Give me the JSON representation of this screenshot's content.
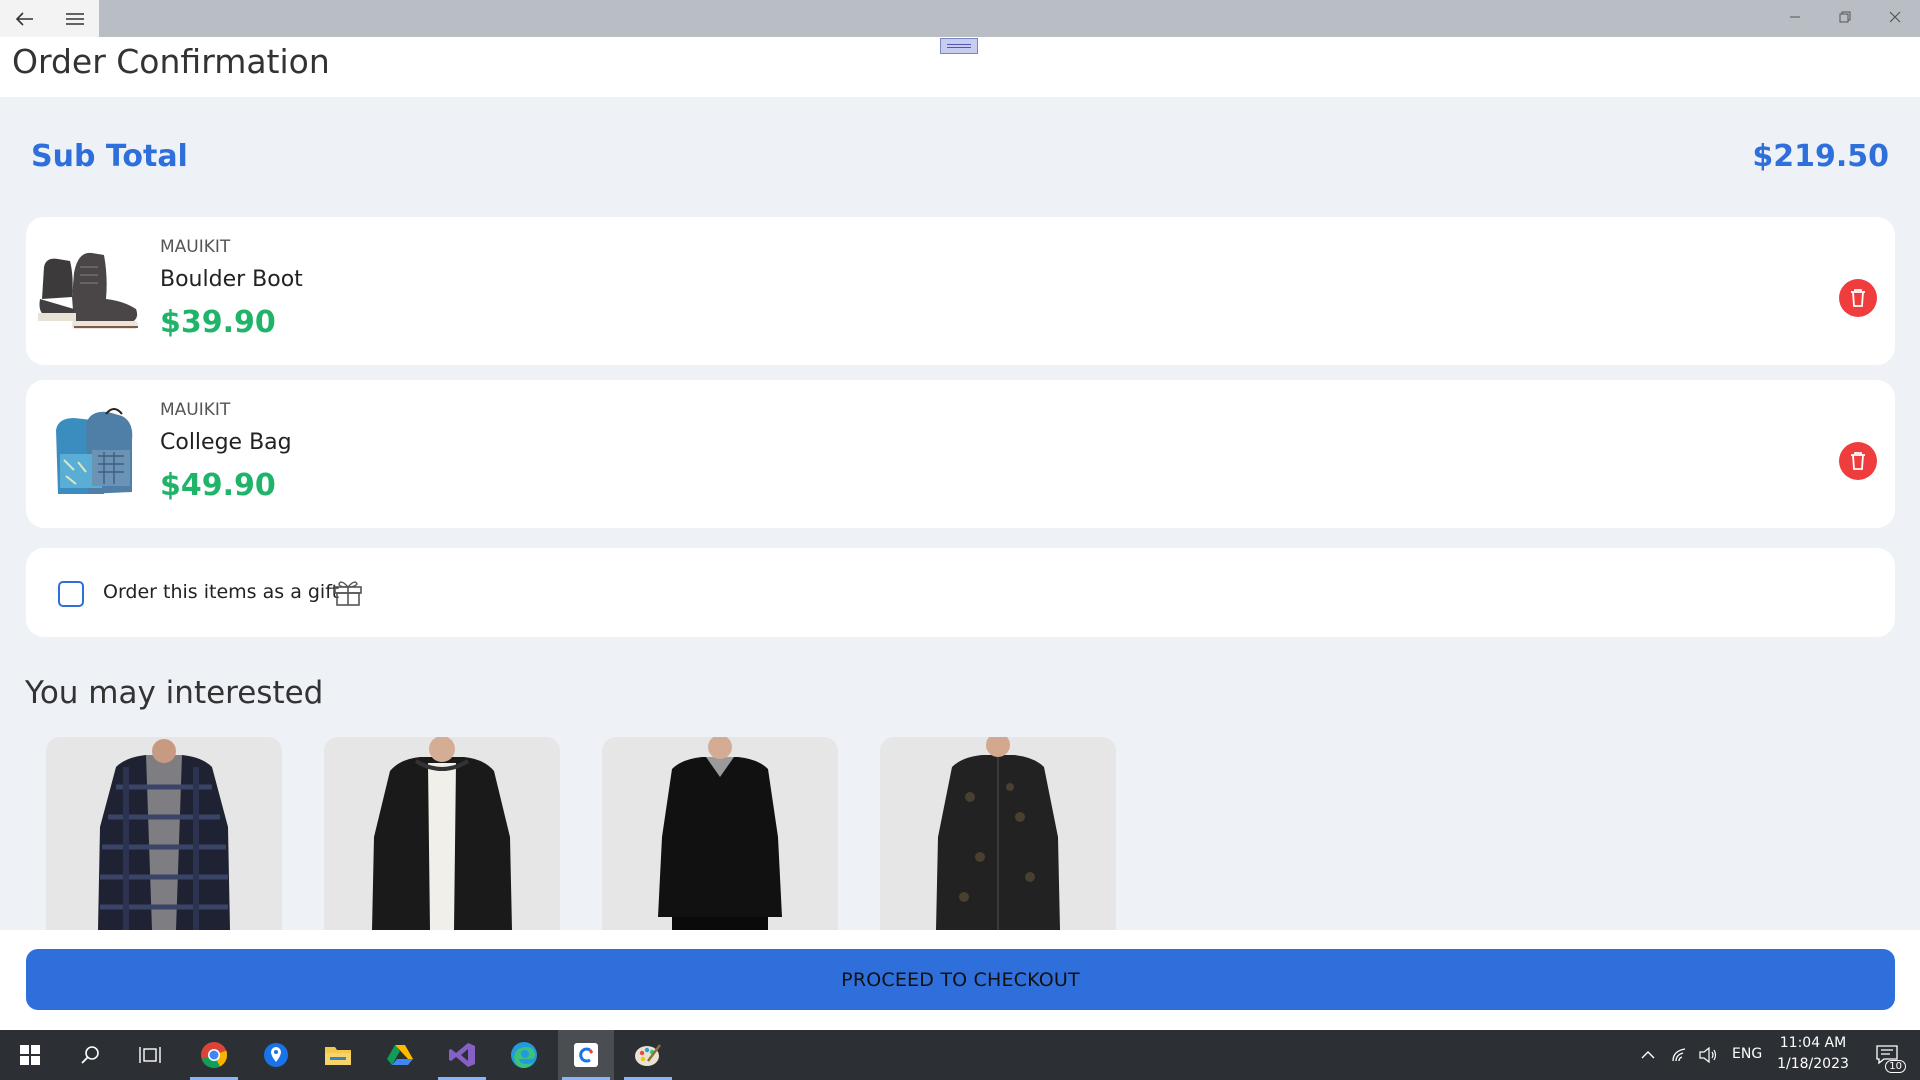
{
  "header": {
    "title": "Order Confirmation"
  },
  "summary": {
    "subtotal_label": "Sub Total",
    "subtotal_value": "$219.50"
  },
  "cart": {
    "items": [
      {
        "brand": "MAUIKIT",
        "name": "Boulder Boot",
        "price": "$39.90",
        "image": "boot-image"
      },
      {
        "brand": "MAUIKIT",
        "name": "College Bag",
        "price": "$49.90",
        "image": "backpack-image"
      }
    ]
  },
  "gift": {
    "label": "Order this items as a gift",
    "checked": false
  },
  "recommendations": {
    "title": "You may interested",
    "items": [
      "plaid-shirt-image",
      "black-hoodie-image",
      "black-sweater-image",
      "printed-shirt-image"
    ]
  },
  "checkout": {
    "label": "PROCEED TO CHECKOUT"
  },
  "taskbar": {
    "language": "ENG",
    "time": "11:04 AM",
    "date": "1/18/2023",
    "notification_count": "10"
  },
  "colors": {
    "accent": "#2f6fdb",
    "price": "#1fb46a",
    "delete": "#ef3c3c"
  }
}
